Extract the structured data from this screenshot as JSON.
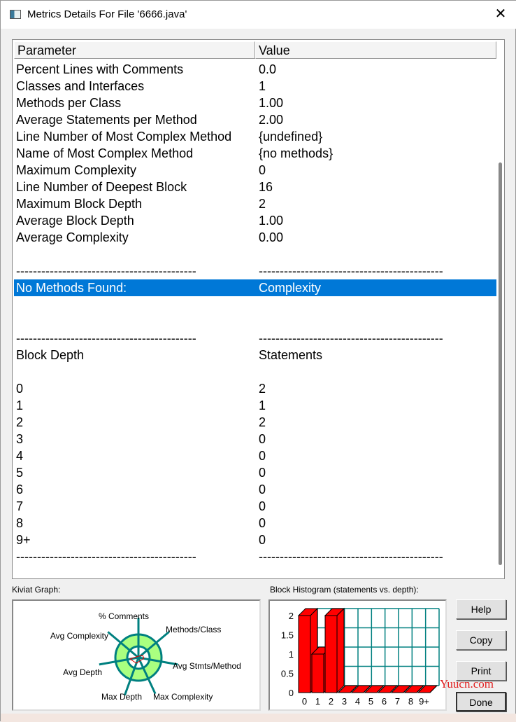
{
  "window": {
    "title": "Metrics Details For File '6666.java'",
    "close": "✕"
  },
  "table": {
    "headers": [
      "Parameter",
      "Value"
    ],
    "rows": [
      [
        "Percent Lines with Comments",
        "0.0"
      ],
      [
        "Classes and Interfaces",
        "1"
      ],
      [
        "Methods per Class",
        "1.00"
      ],
      [
        "Average Statements per Method",
        "2.00"
      ],
      [
        "Line Number of Most Complex Method",
        "{undefined}"
      ],
      [
        "Name of Most Complex Method",
        "{no methods}"
      ],
      [
        "Maximum Complexity",
        "0"
      ],
      [
        "Line Number of Deepest Block",
        "16"
      ],
      [
        "Maximum Block Depth",
        "2"
      ],
      [
        "Average Block Depth",
        "1.00"
      ],
      [
        "Average Complexity",
        "0.00"
      ],
      [
        "",
        ""
      ],
      [
        "-------------------------------------------",
        "--------------------------------------------"
      ],
      [
        "No Methods Found:",
        "Complexity"
      ],
      [
        "",
        ""
      ],
      [
        "",
        ""
      ],
      [
        "-------------------------------------------",
        "--------------------------------------------"
      ],
      [
        "Block Depth",
        "Statements"
      ],
      [
        "",
        ""
      ],
      [
        "0",
        "2"
      ],
      [
        "1",
        "1"
      ],
      [
        "2",
        "2"
      ],
      [
        "3",
        "0"
      ],
      [
        "4",
        "0"
      ],
      [
        "5",
        "0"
      ],
      [
        "6",
        "0"
      ],
      [
        "7",
        "0"
      ],
      [
        "8",
        "0"
      ],
      [
        "9+",
        "0"
      ],
      [
        "-------------------------------------------",
        "--------------------------------------------"
      ]
    ],
    "selected_row": 13
  },
  "kiviat": {
    "label": "Kiviat Graph:",
    "axes": [
      "% Comments",
      "Methods/Class",
      "Avg Stmts/Method",
      "Max Complexity",
      "Max Depth",
      "Avg Depth",
      "Avg Complexity"
    ]
  },
  "histogram": {
    "label": "Block Histogram (statements vs. depth):"
  },
  "chart_data": {
    "type": "bar",
    "categories": [
      "0",
      "1",
      "2",
      "3",
      "4",
      "5",
      "6",
      "7",
      "8",
      "9+"
    ],
    "values": [
      2,
      1,
      2,
      0,
      0,
      0,
      0,
      0,
      0,
      0
    ],
    "yticks": [
      "0",
      "0.5",
      "1",
      "1.5",
      "2"
    ],
    "ylim": [
      0,
      2
    ],
    "grid": true,
    "bar_color": "#ff0000",
    "grid_color": "#008080"
  },
  "buttons": {
    "help": "Help",
    "copy": "Copy",
    "print": "Print",
    "done": "Done"
  },
  "watermark": "Yuucn.com",
  "colors": {
    "selection": "#0078d7",
    "kiviat_fill": "#aaff80",
    "kiviat_line": "#008080"
  }
}
